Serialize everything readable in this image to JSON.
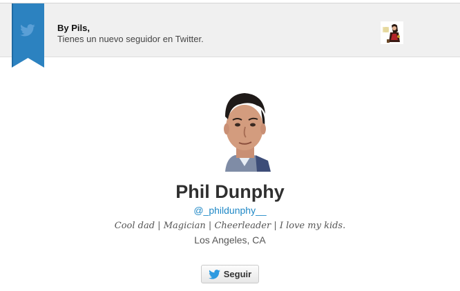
{
  "header": {
    "greeting": "By Pils,",
    "notice": "Tienes un nuevo seguidor en Twitter.",
    "brand_icon": "twitter-bird-icon",
    "ribbon_color": "#2c82c0"
  },
  "profile": {
    "name": "Phil Dunphy",
    "handle": "@_phildunphy__",
    "bio": "Cool dad | Magician | Cheerleader | I love my kids.",
    "location": "Los Angeles, CA"
  },
  "follow_button": {
    "label": "Seguir",
    "icon": "twitter-bird-icon"
  },
  "colors": {
    "link": "#1f88c6",
    "bird_blue": "#2d9ae0"
  }
}
